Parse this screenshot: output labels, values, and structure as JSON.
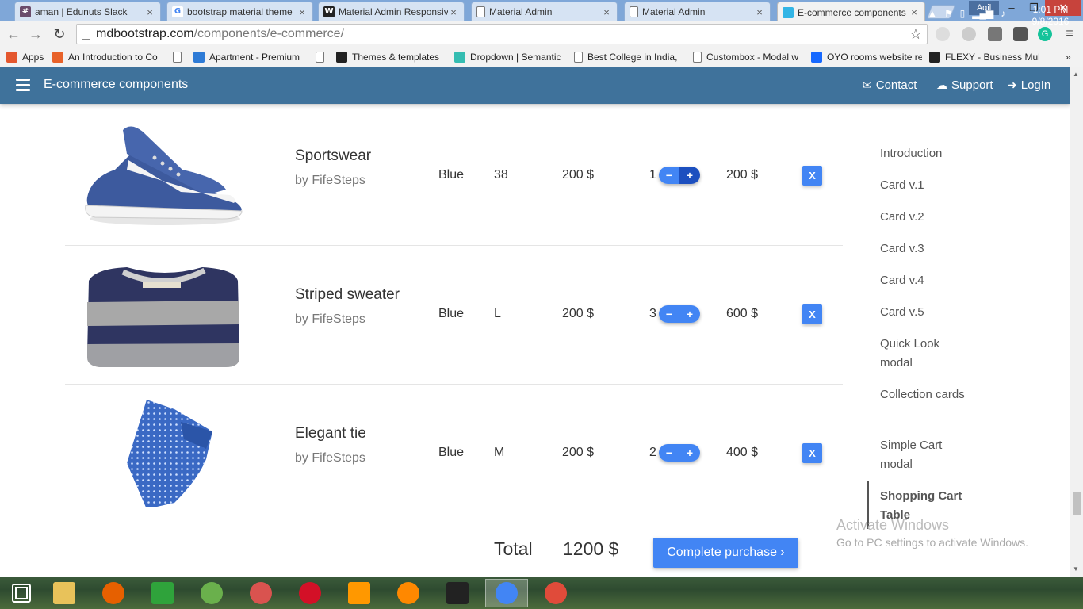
{
  "browser": {
    "tabs": [
      {
        "label": "aman | Edunuts Slack",
        "icon": "slack-hash-icon",
        "icon_glyph": "#",
        "icon_color": "#6b4c6b"
      },
      {
        "label": "bootstrap material theme",
        "icon": "google-icon",
        "icon_glyph": "G",
        "icon_color": "#4285f4"
      },
      {
        "label": "Material Admin Responsiv",
        "icon": "w-icon",
        "icon_glyph": "W",
        "icon_color": "#222222"
      },
      {
        "label": "Material Admin",
        "icon": "page-icon",
        "icon_glyph": "",
        "icon_color": "#ffffff"
      },
      {
        "label": "Material Admin",
        "icon": "page-icon",
        "icon_glyph": "",
        "icon_color": "#ffffff"
      },
      {
        "label": "E-commerce components",
        "icon": "mdb-icon",
        "icon_glyph": "",
        "icon_color": "#33b5e5",
        "active": true
      }
    ],
    "close_glyph": "×",
    "user_name": "Aqil",
    "window_controls": {
      "minimize": "–",
      "restore": "❐",
      "close": "✕"
    },
    "nav": {
      "back": "←",
      "forward": "→",
      "reload": "↻"
    },
    "url_host": "mdbootstrap.com",
    "url_path": "/components/e-commerce/",
    "star": "☆",
    "bookmarks": [
      {
        "label": "Apps",
        "icon": "apps-grid-icon",
        "color": "#e4572e"
      },
      {
        "label": "An Introduction to Co",
        "icon": "plus-icon",
        "color": "#e8622a"
      },
      {
        "label": "",
        "icon": "page-icon",
        "color": "#ffffff"
      },
      {
        "label": "Apartment - Premium",
        "icon": "house-icon",
        "color": "#2e7bd6"
      },
      {
        "label": "",
        "icon": "page-icon",
        "color": "#ffffff"
      },
      {
        "label": "Themes & templates",
        "icon": "w-icon",
        "color": "#222222"
      },
      {
        "label": "Dropdown | Semantic",
        "icon": "s-icon",
        "color": "#35bdb2"
      },
      {
        "label": "Best College in India,",
        "icon": "page-icon",
        "color": "#ffffff"
      },
      {
        "label": "Custombox - Modal w",
        "icon": "page-icon",
        "color": "#ffffff"
      },
      {
        "label": "OYO rooms website re",
        "icon": "behance-icon",
        "color": "#1769ff"
      },
      {
        "label": "FLEXY - Business Mult",
        "icon": "w-icon",
        "color": "#222222"
      }
    ],
    "bookmarks_more": "»"
  },
  "site": {
    "brand": "E-commerce components",
    "nav": [
      {
        "label": "Contact",
        "icon": "envelope-icon",
        "glyph": "✉"
      },
      {
        "label": "Support",
        "icon": "comments-icon",
        "glyph": "☁"
      },
      {
        "label": "LogIn",
        "icon": "sign-in-icon",
        "glyph": "➜"
      }
    ]
  },
  "cart": {
    "rows": [
      {
        "name": "Sportswear",
        "brand": "by FifeSteps",
        "color": "Blue",
        "size": "38",
        "price": "200 $",
        "qty": "1",
        "amount": "200 $",
        "image": "blue-sneaker"
      },
      {
        "name": "Striped sweater",
        "brand": "by FifeSteps",
        "color": "Blue",
        "size": "L",
        "price": "200 $",
        "qty": "3",
        "amount": "600 $",
        "image": "striped-sweater"
      },
      {
        "name": "Elegant tie",
        "brand": "by FifeSteps",
        "color": "Blue",
        "size": "M",
        "price": "200 $",
        "qty": "2",
        "amount": "400 $",
        "image": "blue-tie"
      }
    ],
    "minus": "−",
    "plus": "+",
    "remove": "X",
    "total_label": "Total",
    "total_value": "1200 $",
    "purchase_label": "Complete purchase ›"
  },
  "toc": [
    {
      "label": "Introduction"
    },
    {
      "label": "Card v.1"
    },
    {
      "label": "Card v.2"
    },
    {
      "label": "Card v.3"
    },
    {
      "label": "Card v.4"
    },
    {
      "label": "Card v.5"
    },
    {
      "label": "Quick Look modal"
    },
    {
      "label": "Collection cards"
    },
    {
      "label": "Simple Cart modal"
    },
    {
      "label": "Shopping Cart Table",
      "active": true
    }
  ],
  "watermark": {
    "title": "Activate Windows",
    "subtitle": "Go to PC settings to activate Windows."
  },
  "taskbar": {
    "apps": [
      {
        "name": "start-windows-icon",
        "color": "#ffffff"
      },
      {
        "name": "file-explorer-icon",
        "color": "#e8c25a"
      },
      {
        "name": "firefox-icon",
        "color": "#e66000"
      },
      {
        "name": "store-icon",
        "color": "#2fa33b"
      },
      {
        "name": "frog-app-icon",
        "color": "#6ab04c"
      },
      {
        "name": "snipping-tool-icon",
        "color": "#d9534f"
      },
      {
        "name": "opera-icon",
        "color": "#d31027"
      },
      {
        "name": "sublime-text-icon",
        "color": "#ff9800"
      },
      {
        "name": "vlc-icon",
        "color": "#ff8800"
      },
      {
        "name": "editor-e-icon",
        "color": "#222222"
      },
      {
        "name": "chrome-icon",
        "color": "#4285f4"
      },
      {
        "name": "app-diamond-icon",
        "color": "#e04b3a"
      }
    ],
    "time": "1:01 PM",
    "date": "9/8/2016"
  }
}
